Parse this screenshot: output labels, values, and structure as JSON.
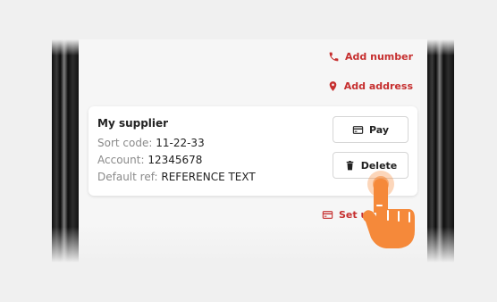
{
  "actions": {
    "add_number": "Add number",
    "add_address": "Add address",
    "set_up": "Set up"
  },
  "payee_card": {
    "name": "My supplier",
    "sort_code_label": "Sort code:",
    "sort_code_value": "11-22-33",
    "account_label": "Account:",
    "account_value": "12345678",
    "default_ref_label": "Default ref:",
    "default_ref_value": "REFERENCE TEXT",
    "pay_label": "Pay",
    "delete_label": "Delete"
  },
  "icons": {
    "add_number": "phone-icon",
    "add_address": "map-pin-icon",
    "pay": "card-icon",
    "delete": "trash-icon",
    "set_up": "card-icon",
    "pointer": "pointing-hand-icon"
  },
  "colors": {
    "accent_red": "#c62f2f",
    "hand_orange": "#f5893a"
  }
}
